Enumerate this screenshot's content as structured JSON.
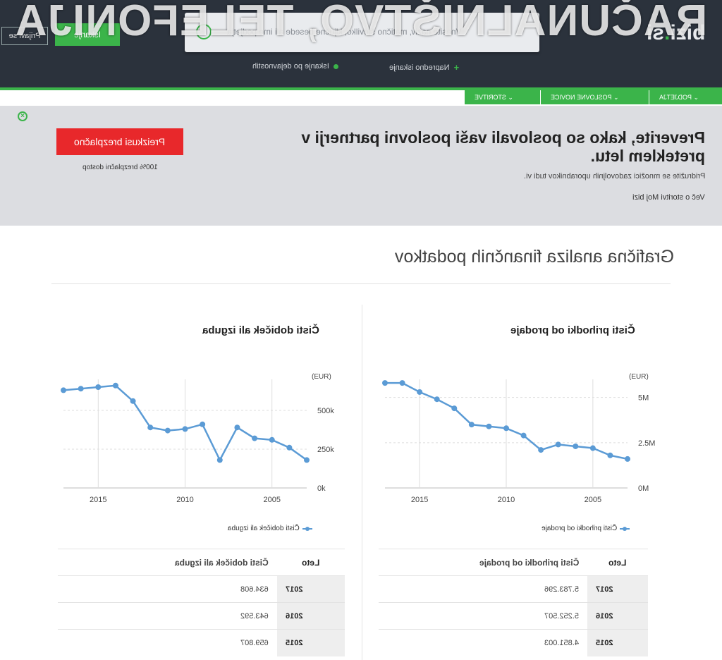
{
  "watermark": "RAČUNALNIŠTVO, TELEFONIJA",
  "header": {
    "login_label": "Prijavi se",
    "cta_label": "Iskanje",
    "search_placeholder": "Vnesite naziv, matično številko, ključne besede ali ime podjetja",
    "logo_text": "bizi",
    "logo_suffix": "si",
    "subnav": [
      "Napredno iskanje",
      "Iskanje po dejavnostih"
    ]
  },
  "tabs": [
    "PODJETJA",
    "POSLOVNE NOVICE",
    "STORITVE"
  ],
  "promo": {
    "title": "Preverite, kako so poslovali vaši poslovni partnerji v preteklem letu.",
    "subtitle": "Pridružite se množici zadovoljnih uporabnikov tudi vi.",
    "link": "Več o storitvi Moj bizi",
    "cta_label": "Preizkusi brezplačno",
    "cta_note": "100% brezplačni dostop"
  },
  "section_title": "Grafična analiza finančnih podatkov",
  "charts": [
    {
      "title": "Čisti prihodki od prodaje",
      "unit": "(EUR)",
      "legend": "Čisti prihodki od prodaje",
      "table_col_year": "Leto",
      "table_col_value": "Čisti prihodki od prodaje",
      "rows": [
        {
          "year": "2017",
          "value": "5.783.296"
        },
        {
          "year": "2016",
          "value": "5.252.507"
        },
        {
          "year": "2015",
          "value": "4.851.003"
        }
      ]
    },
    {
      "title": "Čisti dobiček ali izguba",
      "unit": "(EUR)",
      "legend": "Čisti dobiček ali izguba",
      "table_col_year": "Leto",
      "table_col_value": "Čisti dobiček ali izguba",
      "rows": [
        {
          "year": "2017",
          "value": "634.608"
        },
        {
          "year": "2016",
          "value": "643.592"
        },
        {
          "year": "2015",
          "value": "659.807"
        }
      ]
    }
  ],
  "chart_data": [
    {
      "type": "line",
      "title": "Čisti prihodki od prodaje",
      "ylabel": "(EUR)",
      "x": [
        2003,
        2004,
        2005,
        2006,
        2007,
        2008,
        2009,
        2010,
        2011,
        2012,
        2013,
        2014,
        2015,
        2016,
        2017
      ],
      "x_ticks": [
        "2005",
        "2010",
        "2015"
      ],
      "y_ticks": [
        "0M",
        "2.5M",
        "5M"
      ],
      "ylim": [
        0,
        6000000
      ],
      "series": [
        {
          "name": "Čisti prihodki od prodaje",
          "values": [
            1600000,
            1800000,
            2200000,
            2300000,
            2400000,
            2100000,
            2900000,
            3300000,
            3400000,
            3500000,
            4400000,
            4900000,
            5300000,
            5800000,
            5800000
          ]
        }
      ],
      "color": "#5b9bd5"
    },
    {
      "type": "line",
      "title": "Čisti dobiček ali izguba",
      "ylabel": "(EUR)",
      "x": [
        2003,
        2004,
        2005,
        2006,
        2007,
        2008,
        2009,
        2010,
        2011,
        2012,
        2013,
        2014,
        2015,
        2016,
        2017
      ],
      "x_ticks": [
        "2005",
        "2010",
        "2015"
      ],
      "y_ticks": [
        "0k",
        "250k",
        "500k"
      ],
      "ylim": [
        0,
        700000
      ],
      "series": [
        {
          "name": "Čisti dobiček ali izguba",
          "values": [
            180000,
            260000,
            310000,
            320000,
            390000,
            180000,
            410000,
            380000,
            370000,
            390000,
            560000,
            660000,
            650000,
            640000,
            630000
          ]
        }
      ],
      "color": "#5b9bd5"
    }
  ]
}
